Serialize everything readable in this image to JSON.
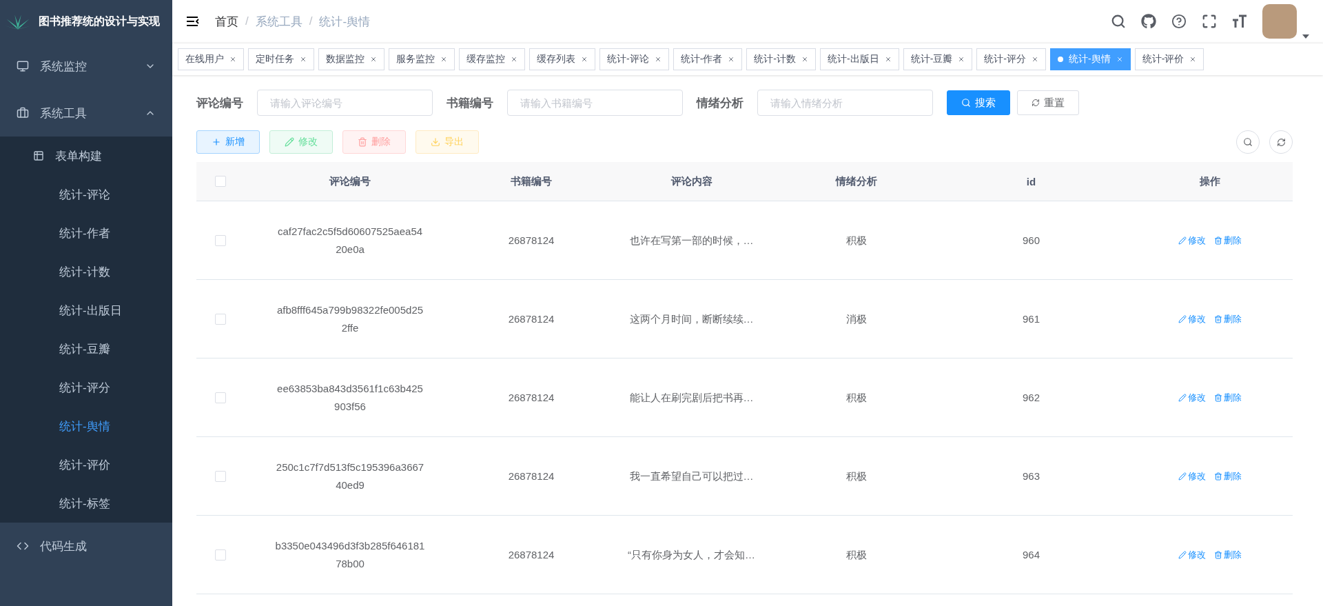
{
  "sidebar": {
    "title": "图书推荐统的设计与实现",
    "menus": [
      {
        "label": "系统监控",
        "expanded": false
      },
      {
        "label": "系统工具",
        "expanded": true,
        "children": [
          {
            "label": "表单构建",
            "kind": "group",
            "selected": false
          },
          {
            "label": "统计-评论",
            "kind": "page",
            "selected": false
          },
          {
            "label": "统计-作者",
            "kind": "page",
            "selected": false
          },
          {
            "label": "统计-计数",
            "kind": "page",
            "selected": false
          },
          {
            "label": "统计-出版日",
            "kind": "page",
            "selected": false
          },
          {
            "label": "统计-豆瓣",
            "kind": "page",
            "selected": false
          },
          {
            "label": "统计-评分",
            "kind": "page",
            "selected": false
          },
          {
            "label": "统计-舆情",
            "kind": "page",
            "selected": true
          },
          {
            "label": "统计-评价",
            "kind": "page",
            "selected": false
          },
          {
            "label": "统计-标签",
            "kind": "page",
            "selected": false
          }
        ]
      },
      {
        "label": "代码生成"
      }
    ]
  },
  "breadcrumb": [
    {
      "label": "首页"
    },
    {
      "separator": "/",
      "label": "系统工具"
    },
    {
      "separator": "/",
      "label": "统计-舆情"
    }
  ],
  "tags": [
    {
      "label": "在线用户",
      "selected": false
    },
    {
      "label": "定时任务",
      "selected": false
    },
    {
      "label": "数据监控",
      "selected": false
    },
    {
      "label": "服务监控",
      "selected": false
    },
    {
      "label": "缓存监控",
      "selected": false
    },
    {
      "label": "缓存列表",
      "selected": false
    },
    {
      "label": "统计-评论",
      "selected": false
    },
    {
      "label": "统计-作者",
      "selected": false
    },
    {
      "label": "统计-计数",
      "selected": false
    },
    {
      "label": "统计-出版日",
      "selected": false
    },
    {
      "label": "统计-豆瓣",
      "selected": false
    },
    {
      "label": "统计-评分",
      "selected": false
    },
    {
      "label": "统计-舆情",
      "selected": true
    },
    {
      "label": "统计-评价",
      "selected": false
    }
  ],
  "filters": [
    {
      "label": "评论编号",
      "placeholder": "请输入评论编号"
    },
    {
      "label": "书籍编号",
      "placeholder": "请输入书籍编号"
    },
    {
      "label": "情绪分析",
      "placeholder": "请输入情绪分析"
    }
  ],
  "filter_buttons": [
    {
      "label": "搜索",
      "kind": "primary"
    },
    {
      "label": "重置",
      "kind": "default"
    }
  ],
  "actions": [
    {
      "label": "新增",
      "kind": "add"
    },
    {
      "label": "修改",
      "kind": "edit"
    },
    {
      "label": "删除",
      "kind": "delete"
    },
    {
      "label": "导出",
      "kind": "export"
    }
  ],
  "table": {
    "all_checked": false,
    "columns": [
      "评论编号",
      "书籍编号",
      "评论内容",
      "情绪分析",
      "id",
      "操作"
    ],
    "rows": [
      {
        "checked": false,
        "comment_id": "caf27fac2c5f5d60607525aea5420e0a",
        "book_id": "26878124",
        "content": "也许在写第一部的时候，…",
        "emotion": "积极",
        "id": "960",
        "actions": [
          "修改",
          "删除"
        ]
      },
      {
        "checked": false,
        "comment_id": "afb8fff645a799b98322fe005d252ffe",
        "book_id": "26878124",
        "content": "这两个月时间，断断续续…",
        "emotion": "消极",
        "id": "961",
        "actions": [
          "修改",
          "删除"
        ]
      },
      {
        "checked": false,
        "comment_id": "ee63853ba843d3561f1c63b425903f56",
        "book_id": "26878124",
        "content": "能让人在刷完剧后把书再…",
        "emotion": "积极",
        "id": "962",
        "actions": [
          "修改",
          "删除"
        ]
      },
      {
        "checked": false,
        "comment_id": "250c1c7f7d513f5c195396a366740ed9",
        "book_id": "26878124",
        "content": "我一直希望自己可以把过…",
        "emotion": "积极",
        "id": "963",
        "actions": [
          "修改",
          "删除"
        ]
      },
      {
        "checked": false,
        "comment_id": "b3350e043496d3f3b285f64618178b00",
        "book_id": "26878124",
        "content": "“只有你身为女人，才会知…",
        "emotion": "积极",
        "id": "964",
        "actions": [
          "修改",
          "删除"
        ]
      }
    ]
  }
}
